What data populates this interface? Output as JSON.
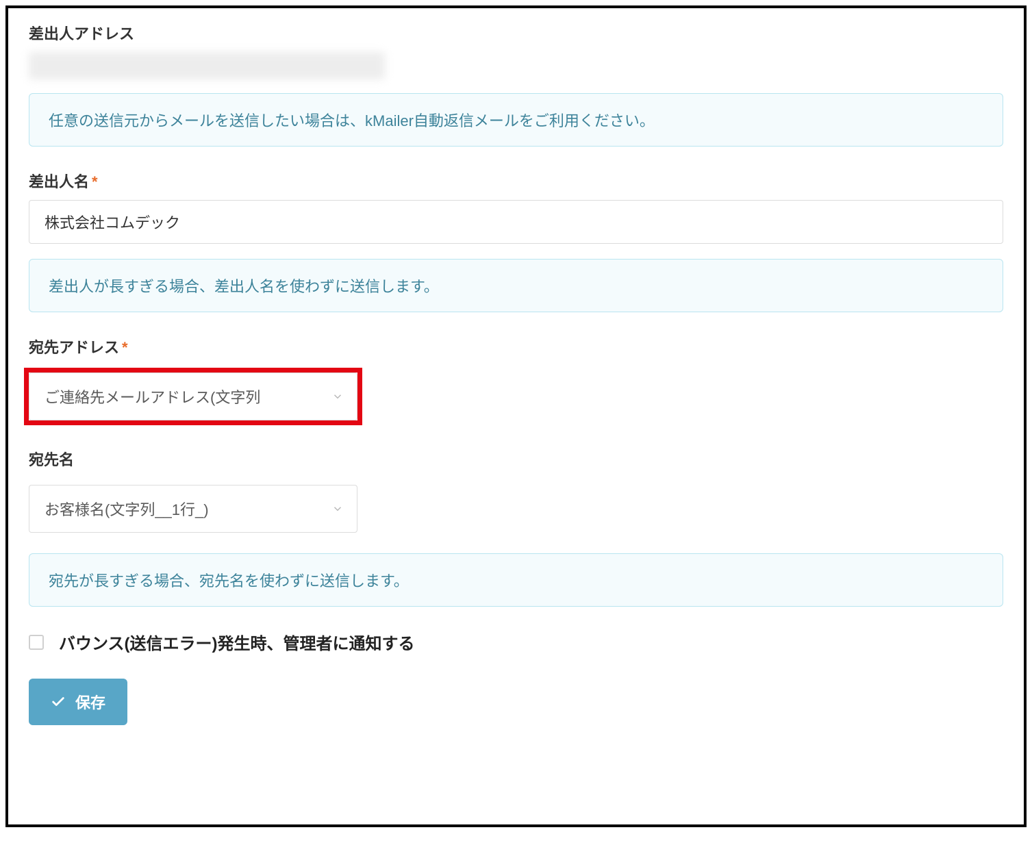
{
  "sender_address": {
    "label": "差出人アドレス",
    "info": "任意の送信元からメールを送信したい場合は、kMailer自動返信メールをご利用ください。"
  },
  "sender_name": {
    "label": "差出人名",
    "value": "株式会社コムデック",
    "info": "差出人が長すぎる場合、差出人名を使わずに送信します。"
  },
  "dest_address": {
    "label": "宛先アドレス",
    "value": "ご連絡先メールアドレス(文字列"
  },
  "dest_name": {
    "label": "宛先名",
    "value": "お客様名(文字列__1行_)",
    "info": "宛先が長すぎる場合、宛先名を使わずに送信します。"
  },
  "bounce": {
    "label": "バウンス(送信エラー)発生時、管理者に通知する"
  },
  "buttons": {
    "save": "保存"
  },
  "required_mark": "*"
}
